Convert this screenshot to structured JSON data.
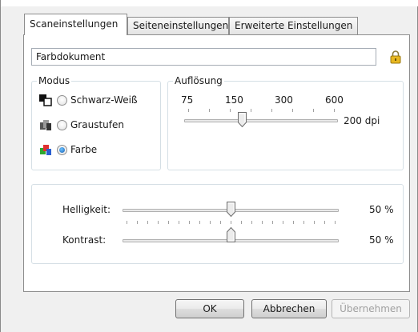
{
  "tabs": [
    {
      "label": "Scaneinstellungen"
    },
    {
      "label": "Seiteneinstellungen"
    },
    {
      "label": "Erweiterte Einstellungen"
    }
  ],
  "profile_name": "Farbdokument",
  "modus": {
    "title": "Modus",
    "options": [
      {
        "label": "Schwarz-Weiß",
        "selected": false,
        "icon": "black-white-icon"
      },
      {
        "label": "Graustufen",
        "selected": false,
        "icon": "grayscale-icon"
      },
      {
        "label": "Farbe",
        "selected": true,
        "icon": "color-icon"
      }
    ]
  },
  "resolution": {
    "title": "Auflösung",
    "scale_labels": [
      "75",
      "150",
      "300",
      "600"
    ],
    "value_label": "200 dpi",
    "level": 0.375
  },
  "adjustments": {
    "brightness": {
      "label": "Helligkeit:",
      "value_label": "50 %",
      "level": 0.5
    },
    "contrast": {
      "label": "Kontrast:",
      "value_label": "50 %",
      "level": 0.5
    }
  },
  "buttons": {
    "ok": "OK",
    "cancel": "Abbrechen",
    "apply": "Übernehmen"
  },
  "colors": {
    "selected_radio": "#1a5fb4",
    "lock": "#e8b820"
  }
}
